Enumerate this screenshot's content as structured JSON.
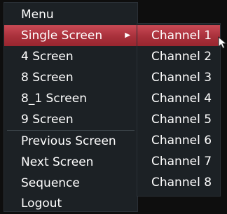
{
  "menu": {
    "items": [
      {
        "label": "Menu"
      },
      {
        "label": "Single Screen",
        "highlighted": true,
        "has_submenu": true
      },
      {
        "label": "4 Screen"
      },
      {
        "label": "8 Screen"
      },
      {
        "label": "8_1 Screen"
      },
      {
        "label": "9 Screen"
      },
      {
        "label": "Previous Screen"
      },
      {
        "label": "Next Screen"
      },
      {
        "label": "Sequence"
      },
      {
        "label": "Logout"
      }
    ],
    "submenu_arrow_icon": "chevron-right-icon"
  },
  "submenu": {
    "items": [
      {
        "label": "Channel 1",
        "highlighted": true
      },
      {
        "label": "Channel 2"
      },
      {
        "label": "Channel 3"
      },
      {
        "label": "Channel 4"
      },
      {
        "label": "Channel 5"
      },
      {
        "label": "Channel 6"
      },
      {
        "label": "Channel 7"
      },
      {
        "label": "Channel 8"
      }
    ]
  },
  "colors": {
    "menu_background": "#1c2125",
    "highlight": "#b23a45",
    "text": "#ffffff"
  }
}
